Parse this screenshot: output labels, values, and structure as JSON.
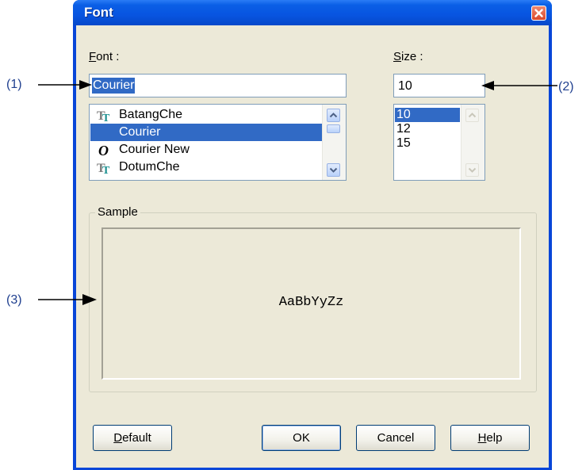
{
  "dialog": {
    "title": "Font"
  },
  "font_section": {
    "label_accel": "F",
    "label_rest": "ont :",
    "input_value": "Courier",
    "list": [
      {
        "label": "BatangChe",
        "icon": "truetype-icon",
        "selected": false
      },
      {
        "label": "Courier",
        "icon": "",
        "selected": true
      },
      {
        "label": "Courier New",
        "icon": "opentype-icon",
        "selected": false
      },
      {
        "label": "DotumChe",
        "icon": "truetype-icon",
        "selected": false
      }
    ]
  },
  "size_section": {
    "label_accel": "S",
    "label_rest": "ize :",
    "input_value": "10",
    "list": [
      {
        "label": "10",
        "selected": true
      },
      {
        "label": "12",
        "selected": false
      },
      {
        "label": "15",
        "selected": false
      }
    ]
  },
  "sample": {
    "label": "Sample",
    "text": "AaBbYyZz"
  },
  "buttons": {
    "default_accel": "D",
    "default_rest": "efault",
    "ok": "OK",
    "cancel": "Cancel",
    "help_accel": "H",
    "help_rest": "elp"
  },
  "annotations": {
    "a1": "(1)",
    "a2": "(2)",
    "a3": "(3)"
  },
  "colors": {
    "selection": "#316ac5",
    "titlebar": "#0854e0",
    "dialog_bg": "#ece9d8"
  }
}
